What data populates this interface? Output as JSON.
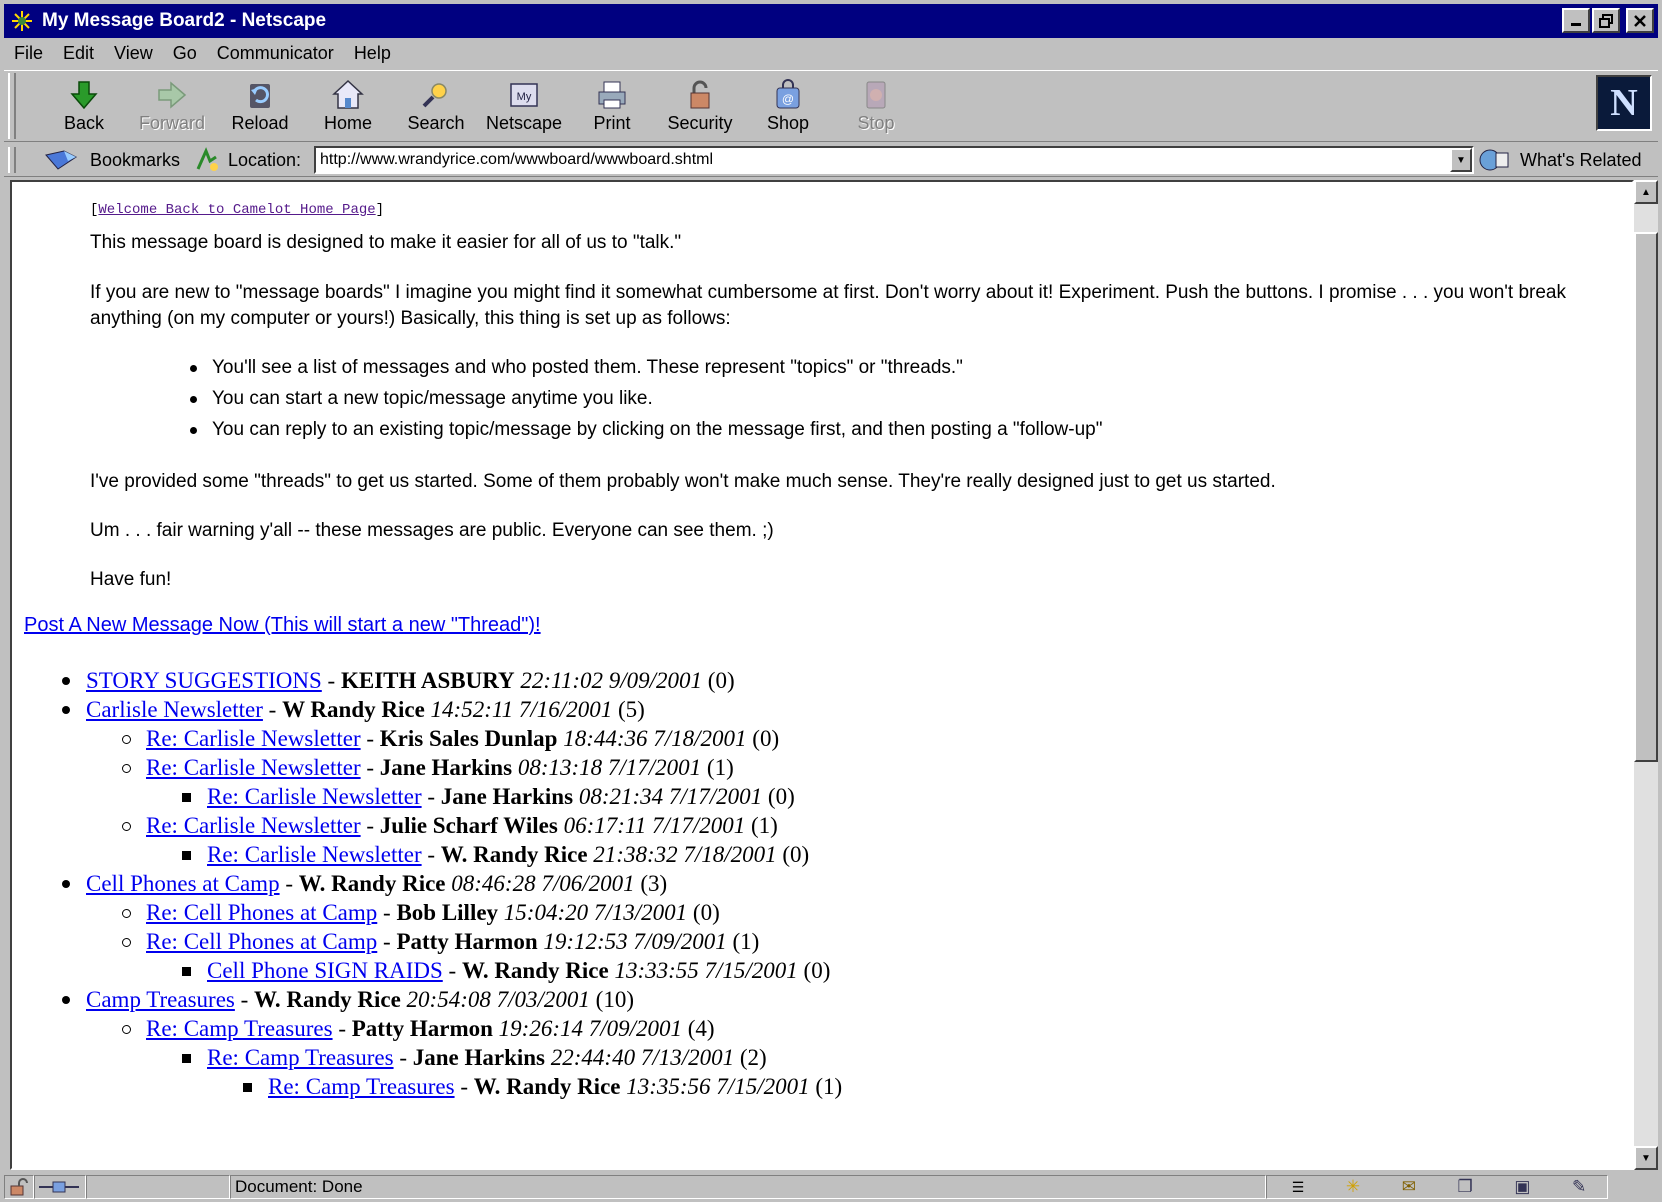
{
  "window": {
    "title": "My Message Board2 - Netscape",
    "controls": [
      "minimize",
      "restore",
      "close"
    ]
  },
  "menu": [
    "File",
    "Edit",
    "View",
    "Go",
    "Communicator",
    "Help"
  ],
  "toolbar": [
    {
      "label": "Back",
      "icon": "back-icon",
      "enabled": true
    },
    {
      "label": "Forward",
      "icon": "forward-icon",
      "enabled": false
    },
    {
      "label": "Reload",
      "icon": "reload-icon",
      "enabled": true
    },
    {
      "label": "Home",
      "icon": "home-icon",
      "enabled": true
    },
    {
      "label": "Search",
      "icon": "search-icon",
      "enabled": true
    },
    {
      "label": "Netscape",
      "icon": "my-netscape-icon",
      "enabled": true
    },
    {
      "label": "Print",
      "icon": "print-icon",
      "enabled": true
    },
    {
      "label": "Security",
      "icon": "lock-icon",
      "enabled": true
    },
    {
      "label": "Shop",
      "icon": "shop-icon",
      "enabled": true
    },
    {
      "label": "Stop",
      "icon": "stop-icon",
      "enabled": false
    }
  ],
  "location": {
    "bookmarks_label": "Bookmarks",
    "location_label": "Location:",
    "url": "http://www.wrandyrice.com/wwwboard/wwwboard.shtml",
    "whats_related": "What's Related"
  },
  "page": {
    "home_link": "Welcome Back to Camelot Home Page",
    "home_link_open": "[",
    "home_link_close": "]",
    "para1": "This message board is designed to make it easier for all of us to \"talk.\"",
    "para2": "If you are new to \"message boards\" I imagine you might find it somewhat cumbersome at first. Don't worry about it! Experiment. Push the buttons. I promise . . . you won't break anything (on my computer or yours!) Basically, this thing is set up as follows:",
    "bullets": [
      "You'll see a list of messages and who posted them. These represent \"topics\" or \"threads.\"",
      "You can start a new topic/message anytime you like.",
      "You can reply to an existing topic/message by clicking on the message first, and then posting a \"follow-up\""
    ],
    "para3": "I've provided some \"threads\" to get us started. Some of them probably won't make much sense. They're really designed just to get us started.",
    "para4": "Um . . . fair warning y'all -- these messages are public. Everyone can see them. ;)",
    "para5": "Have fun!",
    "post_new": "Post A New Message Now (This will start a new \"Thread\")!"
  },
  "threads": [
    {
      "level": 1,
      "subject": "STORY SUGGESTIONS",
      "author": "KEITH ASBURY",
      "time": "22:11:02 9/09/2001",
      "replies": "(0)"
    },
    {
      "level": 1,
      "subject": "Carlisle Newsletter",
      "author": "W Randy Rice",
      "time": "14:52:11 7/16/2001",
      "replies": "(5)"
    },
    {
      "level": 2,
      "subject": "Re: Carlisle Newsletter",
      "author": "Kris Sales Dunlap",
      "time": "18:44:36 7/18/2001",
      "replies": "(0)"
    },
    {
      "level": 2,
      "subject": "Re: Carlisle Newsletter",
      "author": "Jane Harkins",
      "time": "08:13:18 7/17/2001",
      "replies": "(1)"
    },
    {
      "level": 3,
      "subject": "Re: Carlisle Newsletter",
      "author": "Jane Harkins",
      "time": "08:21:34 7/17/2001",
      "replies": "(0)"
    },
    {
      "level": 2,
      "subject": "Re: Carlisle Newsletter",
      "author": "Julie Scharf Wiles",
      "time": "06:17:11 7/17/2001",
      "replies": "(1)"
    },
    {
      "level": 3,
      "subject": "Re: Carlisle Newsletter",
      "author": "W. Randy Rice",
      "time": "21:38:32 7/18/2001",
      "replies": "(0)"
    },
    {
      "level": 1,
      "subject": "Cell Phones at Camp",
      "author": "W. Randy Rice",
      "time": "08:46:28 7/06/2001",
      "replies": "(3)"
    },
    {
      "level": 2,
      "subject": "Re: Cell Phones at Camp",
      "author": "Bob Lilley",
      "time": "15:04:20 7/13/2001",
      "replies": "(0)"
    },
    {
      "level": 2,
      "subject": "Re: Cell Phones at Camp",
      "author": "Patty Harmon",
      "time": "19:12:53 7/09/2001",
      "replies": "(1)"
    },
    {
      "level": 3,
      "subject": "Cell Phone SIGN RAIDS",
      "author": "W. Randy Rice",
      "time": "13:33:55 7/15/2001",
      "replies": "(0)"
    },
    {
      "level": 1,
      "subject": "Camp Treasures",
      "author": "W. Randy Rice",
      "time": "20:54:08 7/03/2001",
      "replies": "(10)"
    },
    {
      "level": 2,
      "subject": "Re: Camp Treasures",
      "author": "Patty Harmon",
      "time": "19:26:14 7/09/2001",
      "replies": "(4)"
    },
    {
      "level": 3,
      "subject": "Re: Camp Treasures",
      "author": "Jane Harkins",
      "time": "22:44:40 7/13/2001",
      "replies": "(2)"
    },
    {
      "level": 4,
      "subject": "Re: Camp Treasures",
      "author": "W. Randy Rice",
      "time": "13:35:56 7/15/2001",
      "replies": "(1)"
    }
  ],
  "status": {
    "text": "Document: Done"
  }
}
